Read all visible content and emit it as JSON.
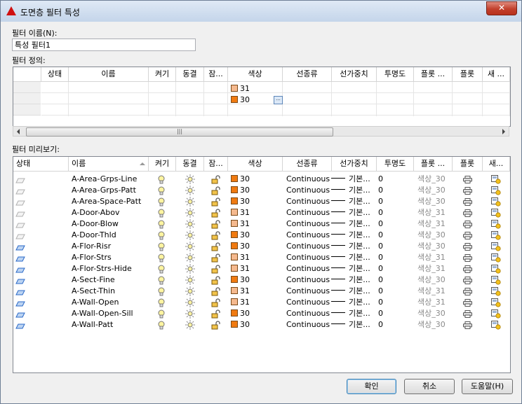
{
  "window": {
    "title": "도면층 필터 특성",
    "close_label": "✕"
  },
  "filter_name": {
    "label": "필터 이름(N):",
    "value": "특성 필터1"
  },
  "filter_def": {
    "label": "필터 정의:",
    "columns": [
      "상태",
      "이름",
      "켜기",
      "동결",
      "잠...",
      "색상",
      "선종류",
      "선가중치",
      "투명도",
      "플롯 ...",
      "플롯",
      "새 ..."
    ],
    "rows": [
      {
        "color_name": "31",
        "color_hex": "#f5b98e"
      },
      {
        "color_name": "30",
        "color_hex": "#f07a10",
        "edit_label": "..."
      }
    ]
  },
  "hscroll_grip": "|||",
  "preview": {
    "label": "필터 미리보기:",
    "columns": [
      "상태",
      "이름",
      "켜기",
      "동결",
      "잠...",
      "색상",
      "선종류",
      "선가중치",
      "투명도",
      "플롯 ...",
      "플롯",
      "새..."
    ],
    "rows": [
      {
        "name": "A-Area-Grps-Line",
        "color": "30",
        "color_hex": "#f07a10",
        "linetype": "Continuous",
        "lineweight": "기본...",
        "transparency": "0",
        "plot_style": "색상_30",
        "status_current": false
      },
      {
        "name": "A-Area-Grps-Patt",
        "color": "30",
        "color_hex": "#f07a10",
        "linetype": "Continuous",
        "lineweight": "기본...",
        "transparency": "0",
        "plot_style": "색상_30",
        "status_current": false
      },
      {
        "name": "A-Area-Space-Patt",
        "color": "30",
        "color_hex": "#f07a10",
        "linetype": "Continuous",
        "lineweight": "기본...",
        "transparency": "0",
        "plot_style": "색상_30",
        "status_current": false
      },
      {
        "name": "A-Door-Abov",
        "color": "31",
        "color_hex": "#f5b98e",
        "linetype": "Continuous",
        "lineweight": "기본...",
        "transparency": "0",
        "plot_style": "색상_31",
        "status_current": false
      },
      {
        "name": "A-Door-Blow",
        "color": "31",
        "color_hex": "#f5b98e",
        "linetype": "Continuous",
        "lineweight": "기본...",
        "transparency": "0",
        "plot_style": "색상_31",
        "status_current": false
      },
      {
        "name": "A-Door-Thld",
        "color": "30",
        "color_hex": "#f07a10",
        "linetype": "Continuous",
        "lineweight": "기본...",
        "transparency": "0",
        "plot_style": "색상_30",
        "status_current": false
      },
      {
        "name": "A-Flor-Risr",
        "color": "30",
        "color_hex": "#f07a10",
        "linetype": "Continuous",
        "lineweight": "기본...",
        "transparency": "0",
        "plot_style": "색상_30",
        "status_current": true
      },
      {
        "name": "A-Flor-Strs",
        "color": "31",
        "color_hex": "#f5b98e",
        "linetype": "Continuous",
        "lineweight": "기본...",
        "transparency": "0",
        "plot_style": "색상_31",
        "status_current": true
      },
      {
        "name": "A-Flor-Strs-Hide",
        "color": "31",
        "color_hex": "#f5b98e",
        "linetype": "Continuous",
        "lineweight": "기본...",
        "transparency": "0",
        "plot_style": "색상_31",
        "status_current": true
      },
      {
        "name": "A-Sect-Fine",
        "color": "30",
        "color_hex": "#f07a10",
        "linetype": "Continuous",
        "lineweight": "기본...",
        "transparency": "0",
        "plot_style": "색상_30",
        "status_current": true
      },
      {
        "name": "A-Sect-Thin",
        "color": "31",
        "color_hex": "#f5b98e",
        "linetype": "Continuous",
        "lineweight": "기본...",
        "transparency": "0",
        "plot_style": "색상_31",
        "status_current": true
      },
      {
        "name": "A-Wall-Open",
        "color": "31",
        "color_hex": "#f5b98e",
        "linetype": "Continuous",
        "lineweight": "기본...",
        "transparency": "0",
        "plot_style": "색상_31",
        "status_current": true
      },
      {
        "name": "A-Wall-Open-Sill",
        "color": "30",
        "color_hex": "#f07a10",
        "linetype": "Continuous",
        "lineweight": "기본...",
        "transparency": "0",
        "plot_style": "색상_30",
        "status_current": true
      },
      {
        "name": "A-Wall-Patt",
        "color": "30",
        "color_hex": "#f07a10",
        "linetype": "Continuous",
        "lineweight": "기본...",
        "transparency": "0",
        "plot_style": "색상_30",
        "status_current": true
      }
    ]
  },
  "buttons": {
    "ok": "확인",
    "cancel": "취소",
    "help": "도움말(H)"
  },
  "icons": {
    "status": "layer-status-icon",
    "on": "lightbulb-icon",
    "freeze": "sun-icon",
    "lock": "unlocked-padlock-icon",
    "plot": "printer-icon",
    "new_vp_freeze": "new-viewport-freeze-icon"
  }
}
